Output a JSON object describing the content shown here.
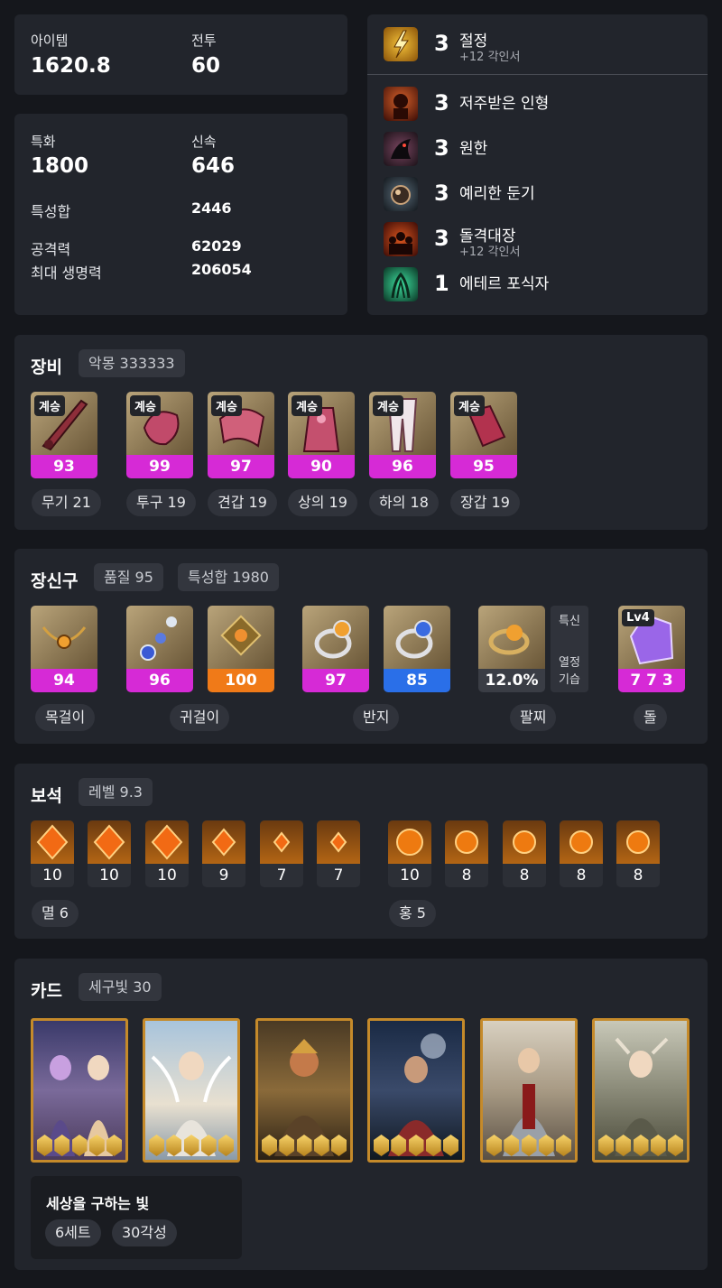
{
  "summary": {
    "item_label": "아이템",
    "item_value": "1620.8",
    "battle_label": "전투",
    "battle_value": "60"
  },
  "stats": {
    "crit_label": "특화",
    "crit_value": "1800",
    "swift_label": "신속",
    "swift_value": "646",
    "total_label": "특성합",
    "total_value": "2446",
    "atk_label": "공격력",
    "atk_value": "62029",
    "hp_label": "최대 생명력",
    "hp_value": "206054"
  },
  "engravings": [
    {
      "icon": "lightning-engraving-icon",
      "level": "3",
      "name": "절정",
      "sub": "+12 각인서"
    },
    {
      "icon": "cursed-doll-engraving-icon",
      "level": "3",
      "name": "저주받은 인형",
      "sub": ""
    },
    {
      "icon": "grudge-engraving-icon",
      "level": "3",
      "name": "원한",
      "sub": ""
    },
    {
      "icon": "keen-blunt-engraving-icon",
      "level": "3",
      "name": "예리한 둔기",
      "sub": ""
    },
    {
      "icon": "raid-captain-engraving-icon",
      "level": "3",
      "name": "돌격대장",
      "sub": "+12 각인서"
    },
    {
      "icon": "ether-predator-engraving-icon",
      "level": "1",
      "name": "에테르 포식자",
      "sub": ""
    }
  ],
  "equipment": {
    "title": "장비",
    "badge": "악몽 333333",
    "items": [
      {
        "tag": "계승",
        "quality": "93",
        "caption": "무기 21",
        "icon": "weapon-icon"
      },
      {
        "tag": "계승",
        "quality": "99",
        "caption": "투구 19",
        "icon": "helmet-icon"
      },
      {
        "tag": "계승",
        "quality": "97",
        "caption": "견갑 19",
        "icon": "shoulder-icon"
      },
      {
        "tag": "계승",
        "quality": "90",
        "caption": "상의 19",
        "icon": "chest-icon"
      },
      {
        "tag": "계승",
        "quality": "96",
        "caption": "하의 18",
        "icon": "pants-icon"
      },
      {
        "tag": "계승",
        "quality": "95",
        "caption": "장갑 19",
        "icon": "gloves-icon"
      }
    ]
  },
  "accessories": {
    "title": "장신구",
    "badge1": "품질 95",
    "badge2": "특성합 1980",
    "items": [
      {
        "quality": "94",
        "icon": "necklace-icon"
      },
      {
        "quality": "96",
        "icon": "earring-icon"
      },
      {
        "quality": "100",
        "icon": "earring-icon"
      },
      {
        "quality": "97",
        "icon": "ring-icon"
      },
      {
        "quality": "85",
        "icon": "ring-icon"
      },
      {
        "quality": "12.0%",
        "icon": "bracelet-icon"
      },
      {
        "quality": "7 7 3",
        "icon": "stone-icon",
        "tag": "Lv4"
      }
    ],
    "bracelet_side": {
      "line1": "특신",
      "line2": "열정",
      "line3": "기습"
    },
    "captions": [
      "목걸이",
      "귀걸이",
      "반지",
      "팔찌",
      "돌"
    ],
    "colors": {
      "purple": "#d62ad6",
      "orange": "#f07a18",
      "blue": "#2a6fe8"
    }
  },
  "gems": {
    "title": "보석",
    "badge": "레벨 9.3",
    "left_values": [
      "10",
      "10",
      "10",
      "9",
      "7",
      "7"
    ],
    "right_values": [
      "10",
      "8",
      "8",
      "8",
      "8"
    ],
    "left_caption": "멸 6",
    "right_caption": "홍 5"
  },
  "cards": {
    "title": "카드",
    "badge": "세구빛 30",
    "set_name": "세상을 구하는 빛",
    "set_badge1": "6세트",
    "set_badge2": "30각성",
    "count": 6
  }
}
